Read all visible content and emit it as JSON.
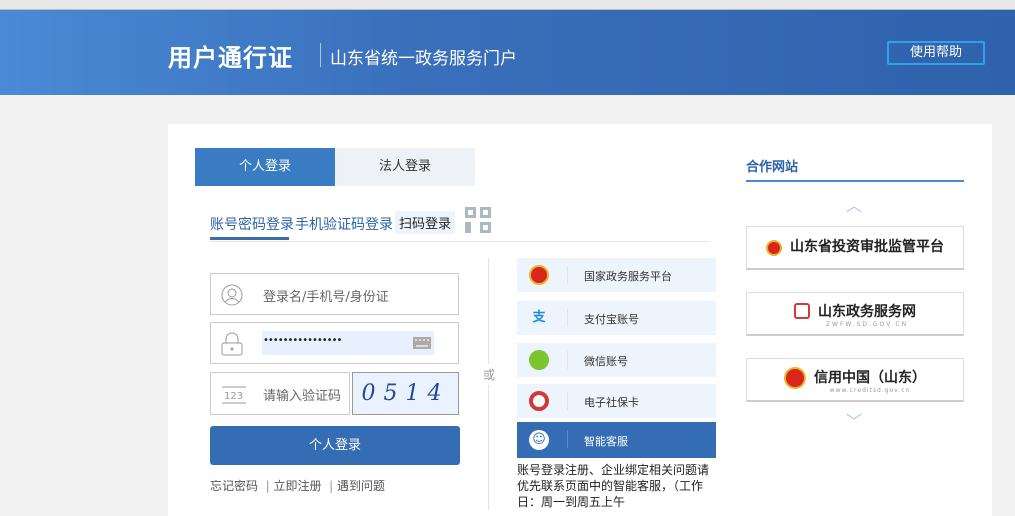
{
  "header": {
    "brand": "用户通行证",
    "subtitle": "山东省统一政务服务门户",
    "help": "使用帮助"
  },
  "login": {
    "tabs": [
      "个人登录",
      "法人登录"
    ],
    "subtabs": [
      "账号密码登录",
      "手机验证码登录",
      "扫码登录"
    ],
    "username_placeholder": "登录名/手机号/身份证",
    "password_value": "••••••••••••••••",
    "captcha_placeholder": "请输入验证码",
    "captcha_code": "0514",
    "submit": "个人登录",
    "links": [
      "忘记密码",
      "立即注册",
      "遇到问题"
    ],
    "or": "或"
  },
  "third_party": [
    {
      "label": "国家政务服务平台",
      "icon": "national-emblem-icon"
    },
    {
      "label": "支付宝账号",
      "icon": "alipay-icon"
    },
    {
      "label": "微信账号",
      "icon": "wechat-icon"
    },
    {
      "label": "电子社保卡",
      "icon": "social-security-card-icon"
    },
    {
      "label": "智能客服",
      "icon": "smart-service-icon"
    }
  ],
  "note": "账号登录注册、企业绑定相关问题请优先联系页面中的智能客服，（工作日：周一到周五上午",
  "partners": {
    "title": "合作网站",
    "items": [
      {
        "name": "山东省投资审批监管平台"
      },
      {
        "name": "山东政务服务网",
        "url": "ZWFW.SD.GOV.CN"
      },
      {
        "name": "信用中国（山东）",
        "url": "www.creditsd.gov.cn"
      }
    ]
  },
  "colors": {
    "primary": "#356db5",
    "accent": "#2d62a8"
  }
}
